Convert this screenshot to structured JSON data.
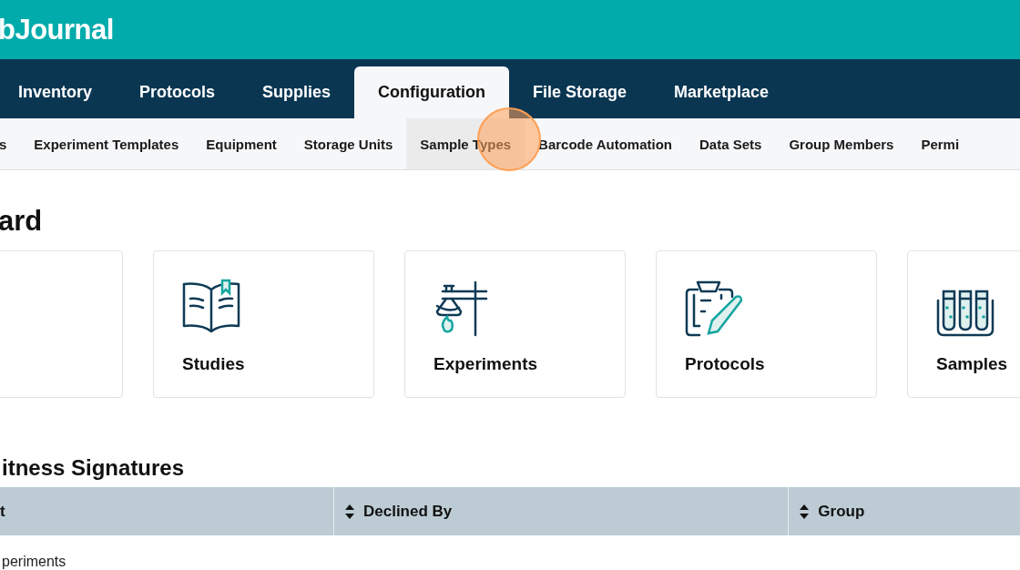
{
  "header": {
    "logo": "bJournal"
  },
  "nav": [
    {
      "label": "Inventory",
      "selected": false
    },
    {
      "label": "Protocols",
      "selected": false
    },
    {
      "label": "Supplies",
      "selected": false
    },
    {
      "label": "Configuration",
      "selected": true
    },
    {
      "label": "File Storage",
      "selected": false
    },
    {
      "label": "Marketplace",
      "selected": false
    }
  ],
  "subnav": [
    {
      "label": "s",
      "selected": false
    },
    {
      "label": "Experiment Templates",
      "selected": false
    },
    {
      "label": "Equipment",
      "selected": false
    },
    {
      "label": "Storage Units",
      "selected": false
    },
    {
      "label": "Sample Types",
      "selected": true
    },
    {
      "label": "Barcode Automation",
      "selected": false
    },
    {
      "label": "Data Sets",
      "selected": false
    },
    {
      "label": "Group Members",
      "selected": false
    },
    {
      "label": "Permi",
      "selected": false
    }
  ],
  "page_title": "ard",
  "cards": [
    {
      "kind": "blank"
    },
    {
      "kind": "studies",
      "label": "Studies"
    },
    {
      "kind": "experiments",
      "label": "Experiments"
    },
    {
      "kind": "protocols",
      "label": "Protocols"
    },
    {
      "kind": "samples",
      "label": "Samples"
    }
  ],
  "section_title": "itness Signatures",
  "table": {
    "columns": [
      {
        "label": "t",
        "sortable": false
      },
      {
        "label": "Declined By",
        "sortable": true
      },
      {
        "label": "Group",
        "sortable": true
      }
    ],
    "rows": [
      [
        "periments"
      ]
    ]
  }
}
